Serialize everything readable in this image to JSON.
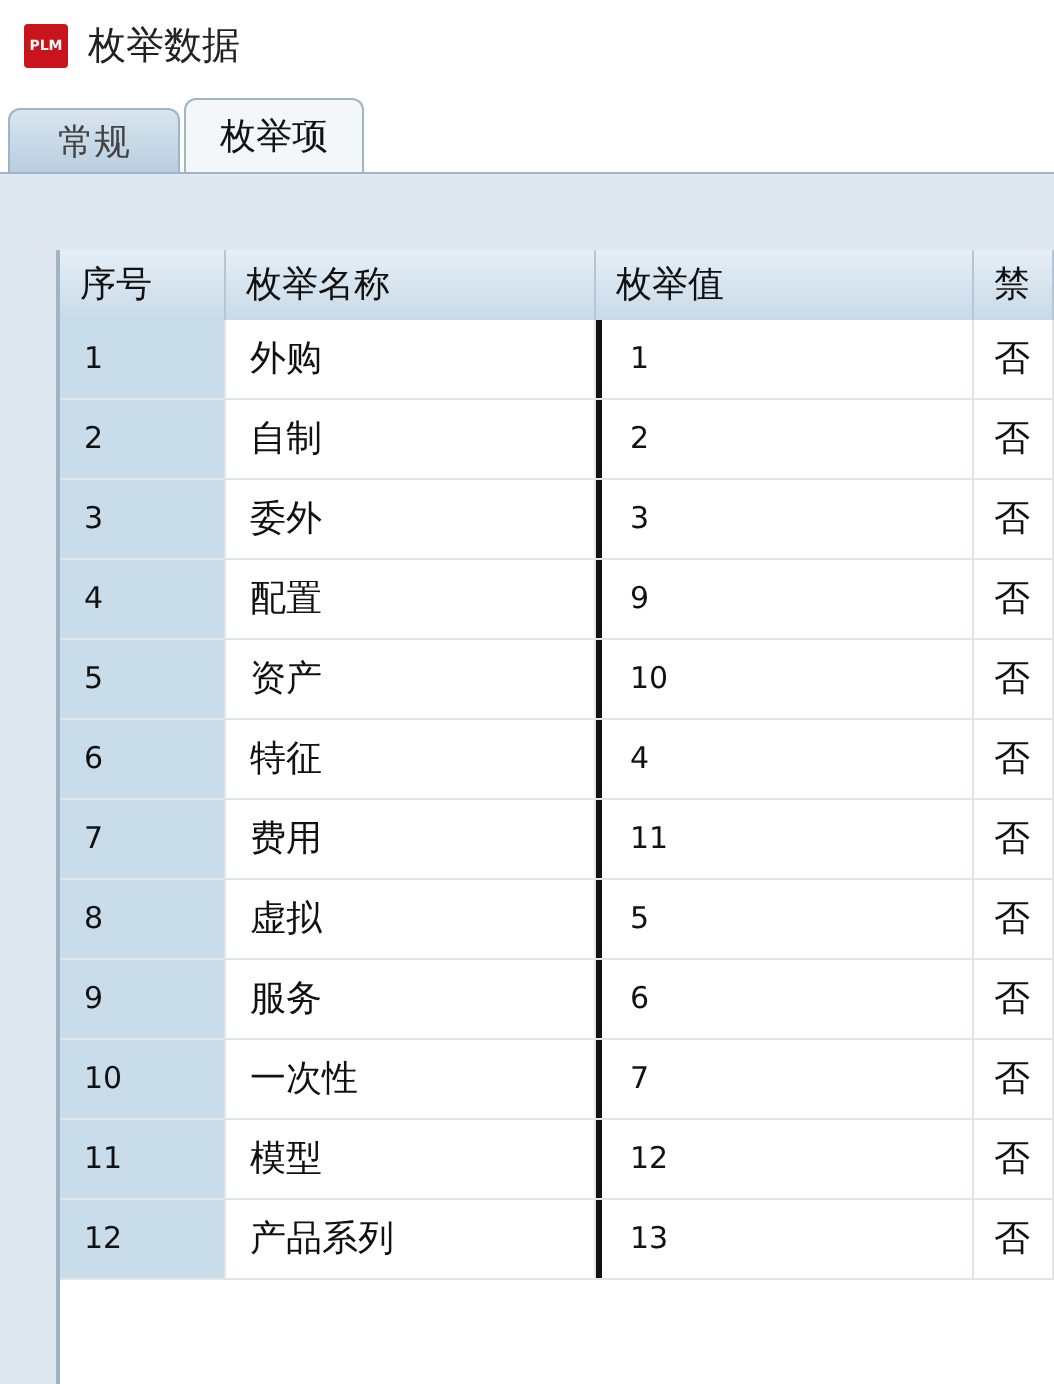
{
  "window": {
    "title": "枚举数据",
    "logo": "PLM"
  },
  "tabs": [
    {
      "label": "常规",
      "selected": false
    },
    {
      "label": "枚举项",
      "selected": true
    }
  ],
  "table": {
    "columns": [
      "序号",
      "枚举名称",
      "枚举值",
      "禁"
    ],
    "rows": [
      [
        "1",
        "外购",
        "1",
        "否"
      ],
      [
        "2",
        "自制",
        "2",
        "否"
      ],
      [
        "3",
        "委外",
        "3",
        "否"
      ],
      [
        "4",
        "配置",
        "9",
        "否"
      ],
      [
        "5",
        "资产",
        "10",
        "否"
      ],
      [
        "6",
        "特征",
        "4",
        "否"
      ],
      [
        "7",
        "费用",
        "11",
        "否"
      ],
      [
        "8",
        "虚拟",
        "5",
        "否"
      ],
      [
        "9",
        "服务",
        "6",
        "否"
      ],
      [
        "10",
        "一次性",
        "7",
        "否"
      ],
      [
        "11",
        "模型",
        "12",
        "否"
      ],
      [
        "12",
        "产品系列",
        "13",
        "否"
      ]
    ]
  }
}
